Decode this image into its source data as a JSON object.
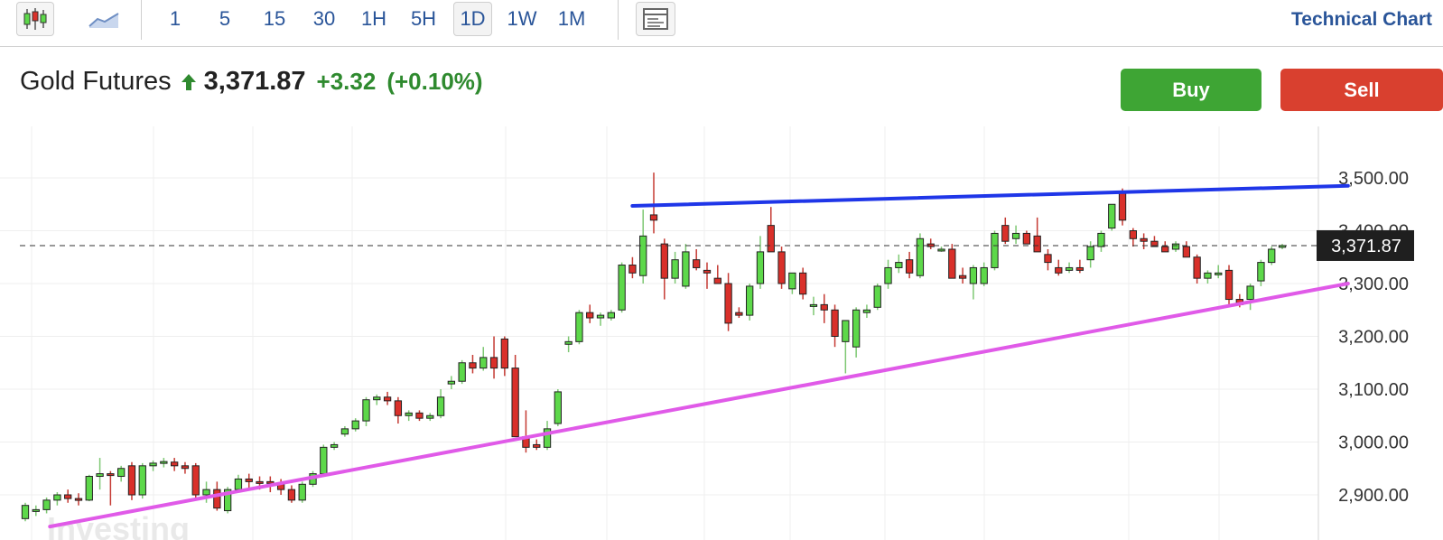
{
  "toolbar": {
    "chart_type_icons": [
      "candlestick-icon",
      "area-chart-icon"
    ],
    "intervals": [
      "1",
      "5",
      "15",
      "30",
      "1H",
      "5H",
      "1D",
      "1W",
      "1M"
    ],
    "active_interval": "1D",
    "layout_icon": "layout-panel-icon",
    "title": "Technical Chart"
  },
  "quote": {
    "name": "Gold Futures",
    "price": "3,371.87",
    "change": "+3.32",
    "change_pct": "(+0.10%)",
    "direction_icon": "arrow-up-icon",
    "up_color": "#2f8a2f"
  },
  "actions": {
    "buy": "Buy",
    "sell": "Sell"
  },
  "chart_data": {
    "type": "candlestick",
    "title": "",
    "xlabel": "",
    "ylabel": "",
    "ylim": [
      2850,
      3560
    ],
    "y_ticks": [
      2900,
      3000,
      3100,
      3200,
      3300,
      3400,
      3500
    ],
    "y_tick_labels": [
      "2,900.00",
      "3,000.00",
      "3,100.00",
      "3,200.00",
      "3,300.00",
      "3,400.00",
      "3,500.00"
    ],
    "current_value": 3371.87,
    "current_label": "3,371.87",
    "grid": true,
    "colors": {
      "up": "#5dd84a",
      "down": "#d9302a",
      "upper_trendline": "#1f36e8",
      "lower_trendline": "#e05ae8"
    },
    "candles": [
      [
        2855,
        2885,
        2850,
        2880
      ],
      [
        2870,
        2880,
        2860,
        2872
      ],
      [
        2872,
        2895,
        2865,
        2890
      ],
      [
        2890,
        2905,
        2880,
        2900
      ],
      [
        2900,
        2910,
        2885,
        2893
      ],
      [
        2893,
        2903,
        2880,
        2890
      ],
      [
        2890,
        2938,
        2888,
        2935
      ],
      [
        2935,
        2970,
        2910,
        2940
      ],
      [
        2940,
        2945,
        2880,
        2938
      ],
      [
        2935,
        2955,
        2925,
        2950
      ],
      [
        2955,
        2962,
        2890,
        2900
      ],
      [
        2900,
        2960,
        2893,
        2955
      ],
      [
        2955,
        2965,
        2945,
        2960
      ],
      [
        2960,
        2970,
        2952,
        2963
      ],
      [
        2962,
        2970,
        2945,
        2955
      ],
      [
        2955,
        2962,
        2940,
        2950
      ],
      [
        2955,
        2960,
        2890,
        2900
      ],
      [
        2900,
        2925,
        2885,
        2910
      ],
      [
        2910,
        2925,
        2870,
        2875
      ],
      [
        2870,
        2915,
        2865,
        2910
      ],
      [
        2910,
        2938,
        2905,
        2930
      ],
      [
        2930,
        2940,
        2910,
        2925
      ],
      [
        2925,
        2935,
        2910,
        2922
      ],
      [
        2925,
        2935,
        2905,
        2922
      ],
      [
        2920,
        2930,
        2900,
        2910
      ],
      [
        2910,
        2918,
        2885,
        2890
      ],
      [
        2890,
        2925,
        2885,
        2920
      ],
      [
        2920,
        2945,
        2915,
        2940
      ],
      [
        2940,
        2995,
        2935,
        2990
      ],
      [
        2990,
        3000,
        2985,
        2995
      ],
      [
        3015,
        3030,
        3010,
        3025
      ],
      [
        3025,
        3045,
        3020,
        3040
      ],
      [
        3040,
        3085,
        3030,
        3080
      ],
      [
        3080,
        3090,
        3070,
        3085
      ],
      [
        3085,
        3095,
        3070,
        3078
      ],
      [
        3078,
        3085,
        3035,
        3050
      ],
      [
        3050,
        3060,
        3040,
        3055
      ],
      [
        3055,
        3060,
        3040,
        3045
      ],
      [
        3045,
        3055,
        3040,
        3050
      ],
      [
        3050,
        3100,
        3045,
        3085
      ],
      [
        3110,
        3125,
        3100,
        3115
      ],
      [
        3115,
        3155,
        3110,
        3150
      ],
      [
        3150,
        3165,
        3130,
        3140
      ],
      [
        3140,
        3180,
        3135,
        3160
      ],
      [
        3160,
        3200,
        3120,
        3140
      ],
      [
        3195,
        3200,
        3125,
        3140
      ],
      [
        3140,
        3165,
        3060,
        3010
      ],
      [
        3010,
        3060,
        2980,
        2990
      ],
      [
        2995,
        3005,
        2985,
        2990
      ],
      [
        2990,
        3040,
        2985,
        3025
      ],
      [
        3035,
        3100,
        3030,
        3095
      ],
      [
        3185,
        3200,
        3170,
        3190
      ],
      [
        3190,
        3250,
        3185,
        3245
      ],
      [
        3245,
        3260,
        3225,
        3235
      ],
      [
        3235,
        3245,
        3220,
        3240
      ],
      [
        3235,
        3250,
        3230,
        3245
      ],
      [
        3250,
        3340,
        3245,
        3335
      ],
      [
        3335,
        3350,
        3310,
        3320
      ],
      [
        3315,
        3440,
        3300,
        3390
      ],
      [
        3430,
        3510,
        3395,
        3420
      ],
      [
        3375,
        3385,
        3270,
        3310
      ],
      [
        3310,
        3360,
        3300,
        3345
      ],
      [
        3295,
        3375,
        3290,
        3360
      ],
      [
        3345,
        3365,
        3325,
        3330
      ],
      [
        3325,
        3340,
        3290,
        3320
      ],
      [
        3310,
        3335,
        3300,
        3300
      ],
      [
        3300,
        3320,
        3210,
        3225
      ],
      [
        3245,
        3255,
        3235,
        3240
      ],
      [
        3240,
        3300,
        3230,
        3295
      ],
      [
        3300,
        3390,
        3290,
        3360
      ],
      [
        3410,
        3445,
        3360,
        3360
      ],
      [
        3360,
        3370,
        3290,
        3300
      ],
      [
        3290,
        3320,
        3280,
        3320
      ],
      [
        3320,
        3330,
        3270,
        3280
      ],
      [
        3260,
        3275,
        3240,
        3260
      ],
      [
        3260,
        3280,
        3225,
        3250
      ],
      [
        3250,
        3260,
        3180,
        3200
      ],
      [
        3190,
        3230,
        3130,
        3230
      ],
      [
        3180,
        3255,
        3160,
        3250
      ],
      [
        3245,
        3260,
        3235,
        3250
      ],
      [
        3255,
        3300,
        3250,
        3295
      ],
      [
        3300,
        3345,
        3290,
        3330
      ],
      [
        3330,
        3355,
        3320,
        3340
      ],
      [
        3345,
        3360,
        3310,
        3320
      ],
      [
        3315,
        3395,
        3310,
        3385
      ],
      [
        3375,
        3385,
        3365,
        3370
      ],
      [
        3365,
        3370,
        3360,
        3365
      ],
      [
        3365,
        3375,
        3310,
        3310
      ],
      [
        3315,
        3330,
        3300,
        3310
      ],
      [
        3300,
        3335,
        3270,
        3330
      ],
      [
        3300,
        3340,
        3295,
        3330
      ],
      [
        3330,
        3400,
        3325,
        3395
      ],
      [
        3410,
        3425,
        3375,
        3380
      ],
      [
        3385,
        3410,
        3375,
        3395
      ],
      [
        3395,
        3400,
        3375,
        3375
      ],
      [
        3390,
        3425,
        3370,
        3360
      ],
      [
        3355,
        3365,
        3325,
        3340
      ],
      [
        3330,
        3345,
        3315,
        3320
      ],
      [
        3325,
        3340,
        3320,
        3330
      ],
      [
        3330,
        3345,
        3320,
        3325
      ],
      [
        3345,
        3380,
        3330,
        3370
      ],
      [
        3370,
        3400,
        3360,
        3395
      ],
      [
        3405,
        3450,
        3400,
        3450
      ],
      [
        3475,
        3480,
        3410,
        3420
      ],
      [
        3400,
        3405,
        3370,
        3385
      ],
      [
        3385,
        3395,
        3365,
        3380
      ],
      [
        3380,
        3390,
        3370,
        3370
      ],
      [
        3370,
        3380,
        3360,
        3360
      ],
      [
        3365,
        3380,
        3360,
        3375
      ],
      [
        3370,
        3380,
        3350,
        3350
      ],
      [
        3350,
        3355,
        3300,
        3310
      ],
      [
        3310,
        3325,
        3300,
        3320
      ],
      [
        3320,
        3335,
        3310,
        3320
      ],
      [
        3325,
        3335,
        3260,
        3270
      ],
      [
        3270,
        3280,
        3255,
        3260
      ],
      [
        3270,
        3300,
        3250,
        3295
      ],
      [
        3305,
        3345,
        3295,
        3340
      ],
      [
        3340,
        3370,
        3335,
        3365
      ],
      [
        3370,
        3375,
        3365,
        3372
      ]
    ],
    "trendlines": [
      {
        "name": "upper",
        "points": [
          [
            0.38,
            3447
          ],
          [
            0.81,
            3485
          ]
        ]
      },
      {
        "name": "lower",
        "points": [
          [
            0.03,
            2840
          ],
          [
            0.81,
            3300
          ]
        ]
      }
    ],
    "watermark": "Investing"
  }
}
